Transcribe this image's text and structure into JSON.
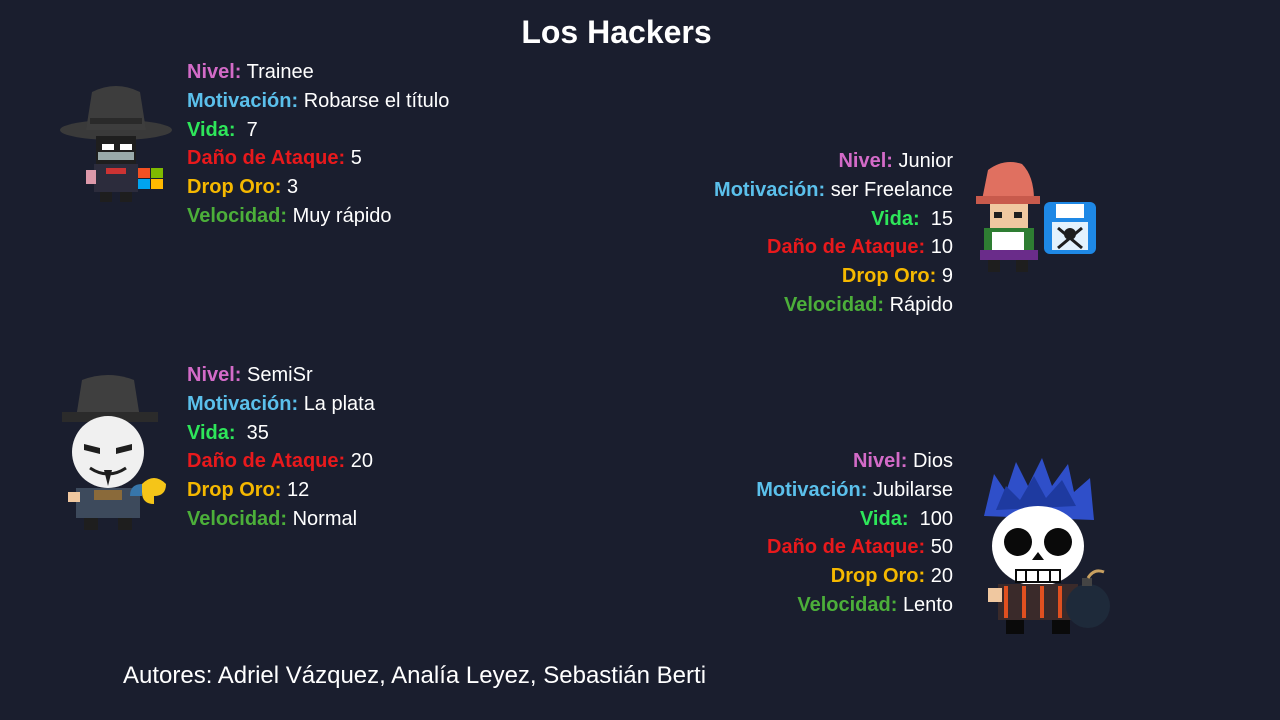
{
  "slide": {
    "title": "Los Hackers",
    "authors": "Autores: Adriel Vázquez, Analía Leyez, Sebastián Berti"
  },
  "colors": {
    "background": "#1a1e2e",
    "nivel": "#d36bc8",
    "motivacion": "#5bc0eb",
    "vida": "#2ee65a",
    "dano": "#e8191c",
    "oro": "#f5b800",
    "velocidad": "#4caf3a",
    "value": "#ffffff"
  },
  "labels": {
    "nivel": "Nivel:",
    "motivacion": "Motivación:",
    "vida": "Vida:",
    "dano": "Daño de Ataque:",
    "oro": "Drop Oro:",
    "velocidad": "Velocidad:"
  },
  "hackers": [
    {
      "sprite": "hacker-trainee-icon",
      "nivel": "Trainee",
      "motivacion": "Robarse el título",
      "vida": "7",
      "dano": "5",
      "oro": "3",
      "velocidad": "Muy rápido"
    },
    {
      "sprite": "hacker-junior-icon",
      "nivel": "Junior",
      "motivacion": "ser Freelance",
      "vida": "15",
      "dano": "10",
      "oro": "9",
      "velocidad": "Rápido"
    },
    {
      "sprite": "hacker-semisr-icon",
      "nivel": "SemiSr",
      "motivacion": "La plata",
      "vida": "35",
      "dano": "20",
      "oro": "12",
      "velocidad": "Normal"
    },
    {
      "sprite": "hacker-dios-icon",
      "nivel": "Dios",
      "motivacion": "Jubilarse",
      "vida": "100",
      "dano": "50",
      "oro": "20",
      "velocidad": "Lento"
    }
  ]
}
